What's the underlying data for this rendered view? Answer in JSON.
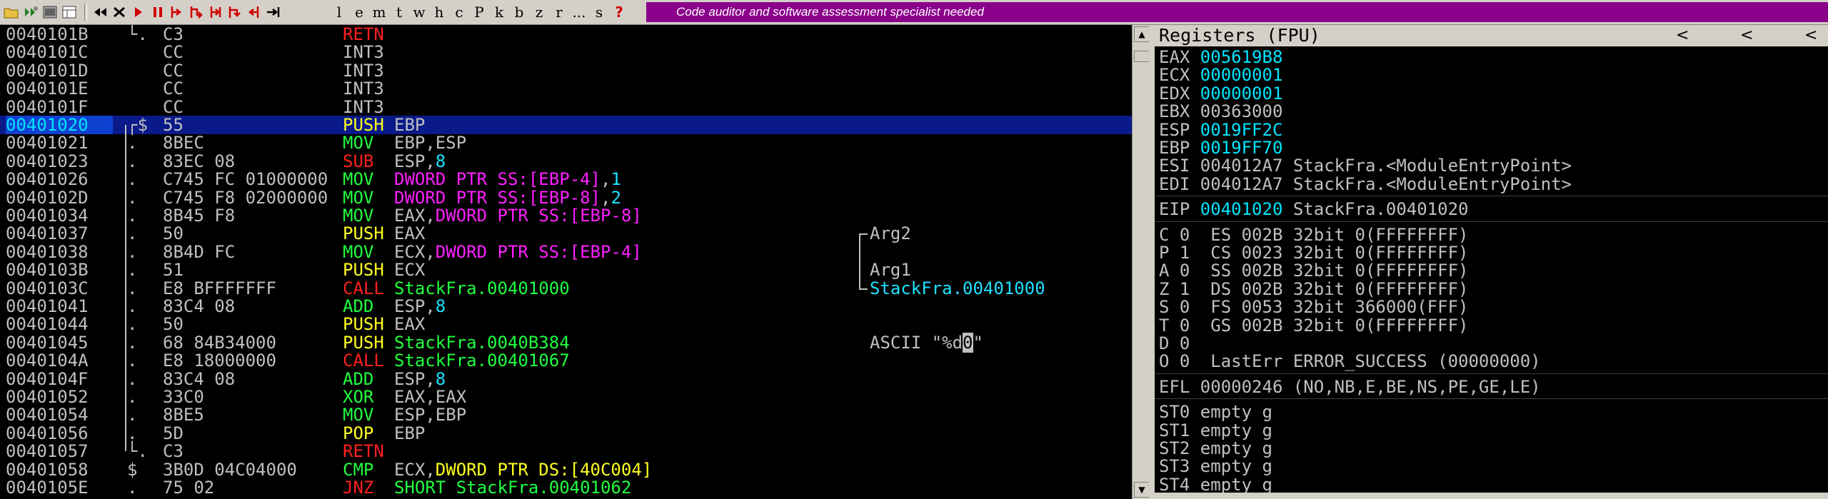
{
  "toolbar": {
    "icons": [
      "open-icon",
      "restart-icon",
      "close-icon",
      "console-icon",
      "windows-icon",
      "rewind-icon",
      "close-process-icon",
      "run-icon",
      "pause-icon",
      "step-into-icon",
      "step-over-icon",
      "trace-into-icon",
      "trace-over-icon",
      "execute-till-return-icon",
      "go-to-icon"
    ],
    "letters": [
      "l",
      "e",
      "m",
      "t",
      "w",
      "h",
      "c",
      "P",
      "k",
      "b",
      "z",
      "r",
      "...",
      "s",
      "?"
    ],
    "banner": "Code auditor and software assessment specialist needed"
  },
  "disasm": {
    "rows": [
      {
        "addr": "0040101B",
        "mark": "└.",
        "hex": "C3",
        "mnem": "RETN",
        "mclass": "m-red",
        "ops": [],
        "comment": ""
      },
      {
        "addr": "0040101C",
        "mark": "",
        "hex": "CC",
        "mnem": "INT3",
        "mclass": "o-gray",
        "ops": [],
        "comment": ""
      },
      {
        "addr": "0040101D",
        "mark": "",
        "hex": "CC",
        "mnem": "INT3",
        "mclass": "o-gray",
        "ops": [],
        "comment": ""
      },
      {
        "addr": "0040101E",
        "mark": "",
        "hex": "CC",
        "mnem": "INT3",
        "mclass": "o-gray",
        "ops": [],
        "comment": ""
      },
      {
        "addr": "0040101F",
        "mark": "",
        "hex": "CC",
        "mnem": "INT3",
        "mclass": "o-gray",
        "ops": [],
        "comment": ""
      },
      {
        "addr": "00401020",
        "mark": "┌$",
        "hex": "55",
        "mnem": "PUSH",
        "mclass": "m-yellow",
        "ops": [
          {
            "t": "EBP",
            "c": "o-gray"
          }
        ],
        "comment": "",
        "selected": true
      },
      {
        "addr": "00401021",
        "mark": ".",
        "hex": "8BEC",
        "mnem": "MOV",
        "mclass": "m-green",
        "ops": [
          {
            "t": "EBP,ESP",
            "c": "o-gray"
          }
        ],
        "comment": ""
      },
      {
        "addr": "00401023",
        "mark": ".",
        "hex": "83EC 08",
        "mnem": "SUB",
        "mclass": "m-red",
        "ops": [
          {
            "t": "ESP,",
            "c": "o-gray"
          },
          {
            "t": "8",
            "c": "o-cyan"
          }
        ],
        "comment": ""
      },
      {
        "addr": "00401026",
        "mark": ".",
        "hex": "C745 FC 01000000",
        "mnem": "MOV",
        "mclass": "m-green",
        "ops": [
          {
            "t": "DWORD PTR SS:[EBP-4]",
            "c": "o-mag"
          },
          {
            "t": ",",
            "c": "o-gray"
          },
          {
            "t": "1",
            "c": "o-cyan"
          }
        ],
        "comment": ""
      },
      {
        "addr": "0040102D",
        "mark": ".",
        "hex": "C745 F8 02000000",
        "mnem": "MOV",
        "mclass": "m-green",
        "ops": [
          {
            "t": "DWORD PTR SS:[EBP-8]",
            "c": "o-mag"
          },
          {
            "t": ",",
            "c": "o-gray"
          },
          {
            "t": "2",
            "c": "o-cyan"
          }
        ],
        "comment": ""
      },
      {
        "addr": "00401034",
        "mark": ".",
        "hex": "8B45 F8",
        "mnem": "MOV",
        "mclass": "m-green",
        "ops": [
          {
            "t": "EAX,",
            "c": "o-gray"
          },
          {
            "t": "DWORD PTR SS:[EBP-8]",
            "c": "o-mag"
          }
        ],
        "comment": ""
      },
      {
        "addr": "00401037",
        "mark": ".",
        "hex": "50",
        "mnem": "PUSH",
        "mclass": "m-yellow",
        "ops": [
          {
            "t": "EAX",
            "c": "o-gray"
          }
        ],
        "comment": "Arg2"
      },
      {
        "addr": "00401038",
        "mark": ".",
        "hex": "8B4D FC",
        "mnem": "MOV",
        "mclass": "m-green",
        "ops": [
          {
            "t": "ECX,",
            "c": "o-gray"
          },
          {
            "t": "DWORD PTR SS:[EBP-4]",
            "c": "o-mag"
          }
        ],
        "comment": ""
      },
      {
        "addr": "0040103B",
        "mark": ".",
        "hex": "51",
        "mnem": "PUSH",
        "mclass": "m-yellow",
        "ops": [
          {
            "t": "ECX",
            "c": "o-gray"
          }
        ],
        "comment": "Arg1"
      },
      {
        "addr": "0040103C",
        "mark": ".",
        "hex": "E8 BFFFFFFF",
        "mnem": "CALL",
        "mclass": "m-red",
        "ops": [
          {
            "t": "StackFra.00401000",
            "c": "o-green"
          }
        ],
        "comment": "StackFra.00401000",
        "ccls": "o-cyan"
      },
      {
        "addr": "00401041",
        "mark": ".",
        "hex": "83C4 08",
        "mnem": "ADD",
        "mclass": "m-green",
        "ops": [
          {
            "t": "ESP,",
            "c": "o-gray"
          },
          {
            "t": "8",
            "c": "o-cyan"
          }
        ],
        "comment": ""
      },
      {
        "addr": "00401044",
        "mark": ".",
        "hex": "50",
        "mnem": "PUSH",
        "mclass": "m-yellow",
        "ops": [
          {
            "t": "EAX",
            "c": "o-gray"
          }
        ],
        "comment": ""
      },
      {
        "addr": "00401045",
        "mark": ".",
        "hex": "68 84B34000",
        "mnem": "PUSH",
        "mclass": "m-yellow",
        "ops": [
          {
            "t": "StackFra.0040B384",
            "c": "o-green"
          }
        ],
        "comment": "",
        "ascii": true
      },
      {
        "addr": "0040104A",
        "mark": ".",
        "hex": "E8 18000000",
        "mnem": "CALL",
        "mclass": "m-red",
        "ops": [
          {
            "t": "StackFra.00401067",
            "c": "o-green"
          }
        ],
        "comment": ""
      },
      {
        "addr": "0040104F",
        "mark": ".",
        "hex": "83C4 08",
        "mnem": "ADD",
        "mclass": "m-green",
        "ops": [
          {
            "t": "ESP,",
            "c": "o-gray"
          },
          {
            "t": "8",
            "c": "o-cyan"
          }
        ],
        "comment": ""
      },
      {
        "addr": "00401052",
        "mark": ".",
        "hex": "33C0",
        "mnem": "XOR",
        "mclass": "m-green",
        "ops": [
          {
            "t": "EAX,EAX",
            "c": "o-gray"
          }
        ],
        "comment": ""
      },
      {
        "addr": "00401054",
        "mark": ".",
        "hex": "8BE5",
        "mnem": "MOV",
        "mclass": "m-green",
        "ops": [
          {
            "t": "ESP,EBP",
            "c": "o-gray"
          }
        ],
        "comment": ""
      },
      {
        "addr": "00401056",
        "mark": ".",
        "hex": "5D",
        "mnem": "POP",
        "mclass": "m-yellow",
        "ops": [
          {
            "t": "EBP",
            "c": "o-gray"
          }
        ],
        "comment": ""
      },
      {
        "addr": "00401057",
        "mark": "└.",
        "hex": "C3",
        "mnem": "RETN",
        "mclass": "m-red",
        "ops": [],
        "comment": ""
      },
      {
        "addr": "00401058",
        "mark": "$",
        "hex": "3B0D 04C04000",
        "mnem": "CMP",
        "mclass": "m-green",
        "ops": [
          {
            "t": "ECX,",
            "c": "o-gray"
          },
          {
            "t": "DWORD PTR DS:[40C004]",
            "c": "o-yellow-ish"
          }
        ],
        "comment": ""
      },
      {
        "addr": "0040105E",
        "mark": ".",
        "hex": "75 02",
        "mnem": "JNZ",
        "mclass": "m-red",
        "ops": [
          {
            "t": "SHORT StackFra.00401062",
            "c": "o-green"
          }
        ],
        "comment": ""
      }
    ],
    "ascii_prefix": "ASCII \"%d",
    "ascii_hl": "0",
    "ascii_suffix": "\""
  },
  "registers": {
    "title": "Registers (FPU)",
    "nav": [
      "<",
      "<",
      "<"
    ],
    "gp": [
      {
        "name": "EAX",
        "value": "005619B8",
        "changed": true,
        "note": ""
      },
      {
        "name": "ECX",
        "value": "00000001",
        "changed": true,
        "note": ""
      },
      {
        "name": "EDX",
        "value": "00000001",
        "changed": true,
        "note": ""
      },
      {
        "name": "EBX",
        "value": "00363000",
        "changed": false,
        "note": ""
      },
      {
        "name": "ESP",
        "value": "0019FF2C",
        "changed": true,
        "note": ""
      },
      {
        "name": "EBP",
        "value": "0019FF70",
        "changed": true,
        "note": ""
      },
      {
        "name": "ESI",
        "value": "004012A7",
        "changed": false,
        "note": "StackFra.<ModuleEntryPoint>"
      },
      {
        "name": "EDI",
        "value": "004012A7",
        "changed": false,
        "note": "StackFra.<ModuleEntryPoint>"
      }
    ],
    "eip": {
      "name": "EIP",
      "value": "00401020",
      "note": "StackFra.00401020"
    },
    "flags": [
      "C 0  ES 002B 32bit 0(FFFFFFFF)",
      "P 1  CS 0023 32bit 0(FFFFFFFF)",
      "A 0  SS 002B 32bit 0(FFFFFFFF)",
      "Z 1  DS 002B 32bit 0(FFFFFFFF)",
      "S 0  FS 0053 32bit 366000(FFF)",
      "T 0  GS 002B 32bit 0(FFFFFFFF)",
      "D 0",
      "O 0  LastErr ERROR_SUCCESS (00000000)"
    ],
    "efl": "EFL 00000246 (NO,NB,E,BE,NS,PE,GE,LE)",
    "fpu": [
      "ST0 empty g",
      "ST1 empty g",
      "ST2 empty g",
      "ST3 empty g",
      "ST4 empty g"
    ]
  }
}
